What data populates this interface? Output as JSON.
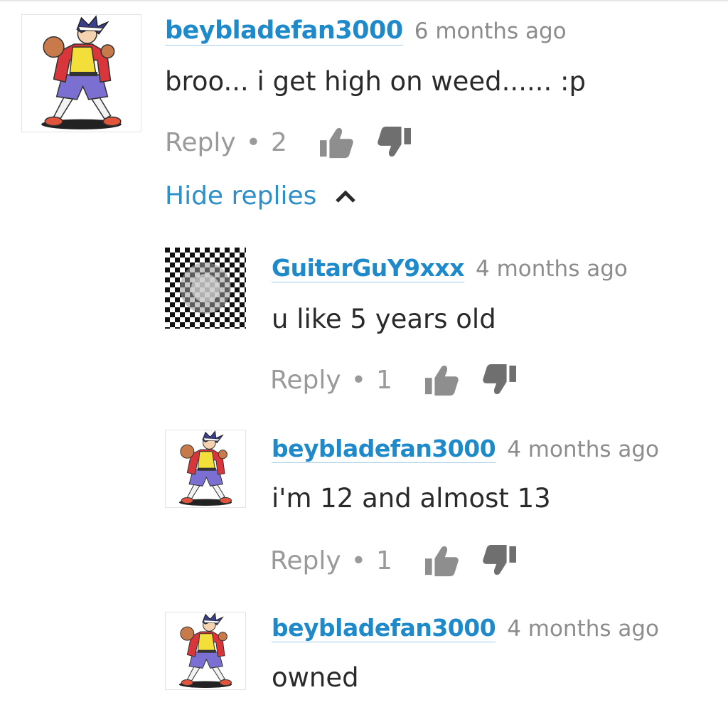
{
  "comments": [
    {
      "author": "beybladefan3000",
      "time": "6 months ago",
      "text": "broo... i get high on weed...... :p",
      "reply_label": "Reply",
      "separator": "•",
      "likes": "2",
      "avatar_icon": "anime-character-avatar-icon"
    },
    {
      "author": "GuitarGuY9xxx",
      "time": "4 months ago",
      "text": "u like 5 years old",
      "reply_label": "Reply",
      "separator": "•",
      "likes": "1",
      "avatar_icon": "checkered-pattern-avatar-icon"
    },
    {
      "author": "beybladefan3000",
      "time": "4 months ago",
      "text": "i'm 12 and almost 13",
      "reply_label": "Reply",
      "separator": "•",
      "likes": "1",
      "avatar_icon": "anime-character-avatar-icon"
    },
    {
      "author": "beybladefan3000",
      "time": "4 months ago",
      "text": "owned",
      "avatar_icon": "anime-character-avatar-icon"
    }
  ],
  "replies_toggle": {
    "label": "Hide replies",
    "icon": "chevron-up-icon"
  },
  "colors": {
    "author": "#1f8ac9",
    "meta": "#8c8c8c",
    "text": "#2a2a2a",
    "action": "#9a9a9a"
  }
}
